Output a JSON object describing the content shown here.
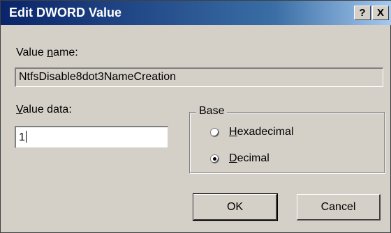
{
  "window": {
    "title": "Edit DWORD Value",
    "help_label": "?",
    "close_label": "X"
  },
  "value_name": {
    "label_pre": "Value ",
    "label_ul": "n",
    "label_post": "ame:",
    "value": "NtfsDisable8dot3NameCreation"
  },
  "value_data": {
    "label_ul": "V",
    "label_post": "alue data:",
    "value": "1"
  },
  "base": {
    "legend": "Base",
    "options": [
      {
        "ul": "H",
        "rest": "exadecimal",
        "checked": false
      },
      {
        "ul": "D",
        "rest": "ecimal",
        "checked": true
      }
    ]
  },
  "buttons": {
    "ok": "OK",
    "cancel": "Cancel"
  }
}
